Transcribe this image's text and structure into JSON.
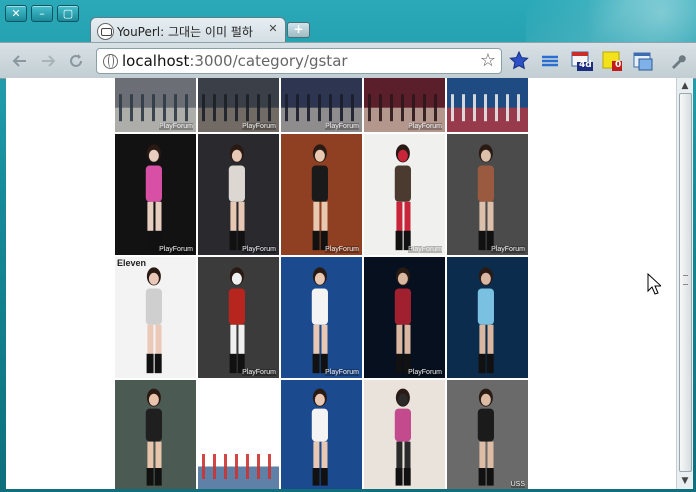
{
  "window": {
    "buttons": [
      "✕",
      "–",
      "▢"
    ]
  },
  "tab": {
    "title": "YouPerl: 그대는 이미 펄하",
    "close_icon": "✕"
  },
  "new_tab_icon": "+",
  "toolbar": {
    "back_icon": "arrow-left-icon",
    "forward_icon": "arrow-right-icon",
    "reload_icon": "reload-icon",
    "url_host": "localhost",
    "url_rest": ":3000/category/gstar",
    "extensions": [
      {
        "name": "blue-star-extension",
        "badge": ""
      },
      {
        "name": "stack-extension",
        "badge": ""
      },
      {
        "name": "calendar-extension",
        "badge": "4d"
      },
      {
        "name": "notes-extension",
        "badge": "0"
      },
      {
        "name": "window-extension",
        "badge": ""
      }
    ],
    "menu_icon": "wrench-icon"
  },
  "thumbnails": [
    {
      "row": 0,
      "col": 0,
      "label": "PlayForum",
      "palette": [
        "#6b6e74",
        "#c9c9c2",
        "#2f3a45"
      ]
    },
    {
      "row": 0,
      "col": 1,
      "label": "PlayForum",
      "palette": [
        "#3a3f48",
        "#8a7e71",
        "#1c2027"
      ]
    },
    {
      "row": 0,
      "col": 2,
      "label": "PlayForum",
      "palette": [
        "#2e3550",
        "#b9b2a6",
        "#1a1d2a"
      ]
    },
    {
      "row": 0,
      "col": 3,
      "label": "PlayForum",
      "palette": [
        "#5a1f2a",
        "#d8c9b7",
        "#2a1619"
      ]
    },
    {
      "row": 0,
      "col": 4,
      "label": "",
      "palette": [
        "#1d4b82",
        "#c33",
        "#e8e8e8"
      ]
    },
    {
      "row": 1,
      "col": 0,
      "label": "PlayForum",
      "palette": [
        "#121212",
        "#d84fa6",
        "#e7cdbf"
      ]
    },
    {
      "row": 1,
      "col": 1,
      "label": "PlayForum",
      "palette": [
        "#29292e",
        "#dcd7d0",
        "#e6c8b4"
      ]
    },
    {
      "row": 1,
      "col": 2,
      "label": "PlayForum",
      "palette": [
        "#8f3f22",
        "#1a1a1a",
        "#e8c8b0"
      ]
    },
    {
      "row": 1,
      "col": 3,
      "label": "PlayForum",
      "palette": [
        "#f0f0ef",
        "#4a3a2f",
        "#c8253a"
      ]
    },
    {
      "row": 1,
      "col": 4,
      "label": "PlayForum",
      "palette": [
        "#4b4b4b",
        "#9a5a40",
        "#ddc0ac"
      ]
    },
    {
      "row": 2,
      "col": 0,
      "label": "Eleven",
      "palette": [
        "#f3f3f3",
        "#cfcfcf",
        "#eac9b8"
      ]
    },
    {
      "row": 2,
      "col": 1,
      "label": "PlayForum",
      "palette": [
        "#3b3b3b",
        "#b6251e",
        "#f0f0f0"
      ]
    },
    {
      "row": 2,
      "col": 2,
      "label": "PlayForum",
      "palette": [
        "#1c4a8f",
        "#f4f4f4",
        "#e8c7b3"
      ]
    },
    {
      "row": 2,
      "col": 3,
      "label": "PlayForum",
      "palette": [
        "#06101f",
        "#a02030",
        "#d9b7a1"
      ]
    },
    {
      "row": 2,
      "col": 4,
      "label": "",
      "palette": [
        "#0b2c4c",
        "#7ac0e0",
        "#d9b7a1"
      ]
    },
    {
      "row": 3,
      "col": 0,
      "label": "",
      "palette": [
        "#4b5a52",
        "#1f1f1f",
        "#e8c4ad"
      ]
    },
    {
      "row": 3,
      "col": 1,
      "label": "",
      "palette": [
        "#ffffff",
        "#1d4b82",
        "#c33"
      ]
    },
    {
      "row": 3,
      "col": 2,
      "label": "",
      "palette": [
        "#1c4a8f",
        "#f4f4f4",
        "#e8c7b3"
      ]
    },
    {
      "row": 3,
      "col": 3,
      "label": "",
      "palette": [
        "#e9e3dc",
        "#c24a8d",
        "#2a2a2a"
      ]
    },
    {
      "row": 3,
      "col": 4,
      "label": "USS",
      "palette": [
        "#6a6a6a",
        "#1b1b1b",
        "#dcbca5"
      ]
    }
  ]
}
